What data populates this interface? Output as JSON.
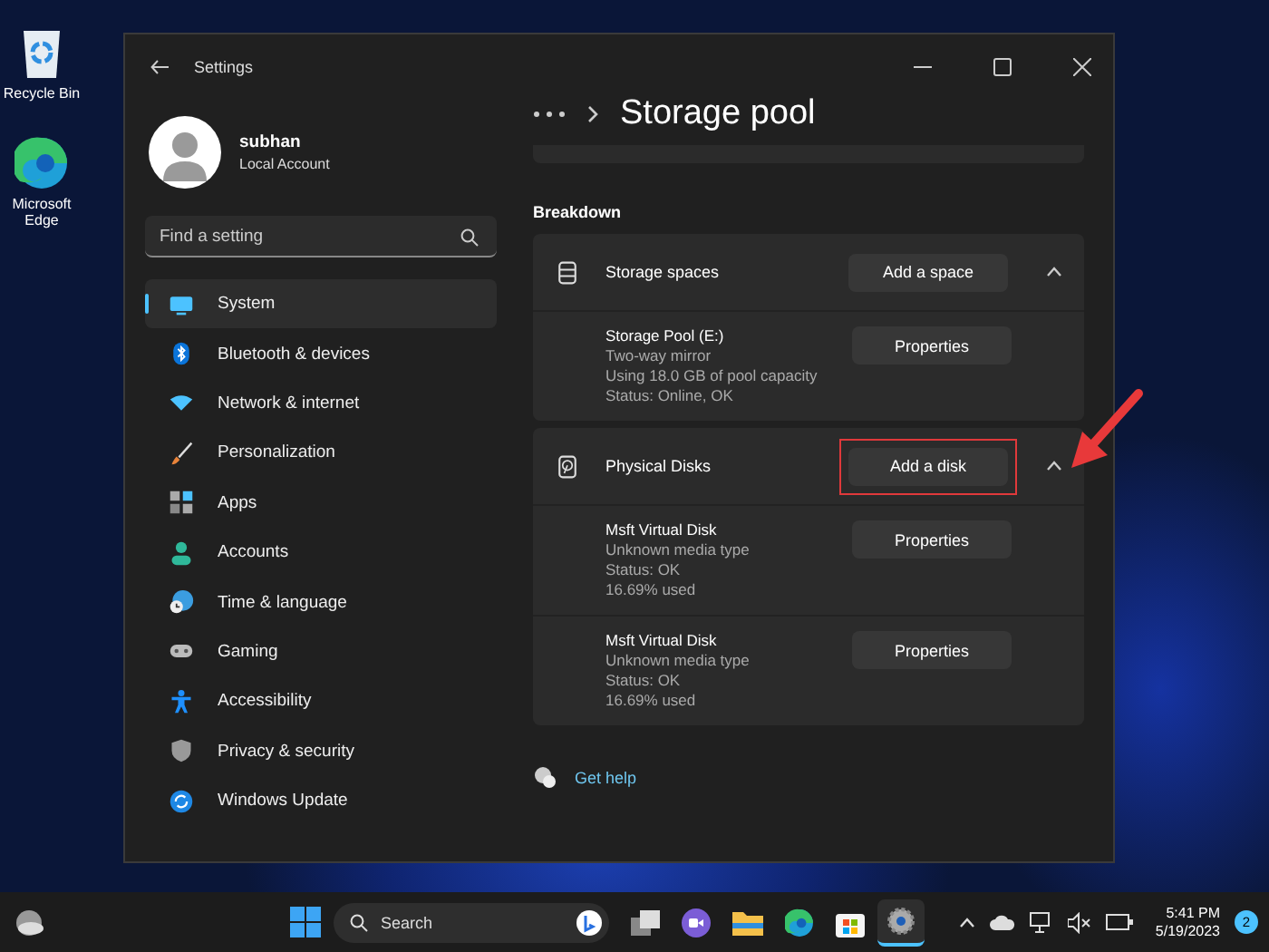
{
  "desktop_icons": [
    {
      "label": "Recycle Bin"
    },
    {
      "label": "Microsoft Edge"
    }
  ],
  "window": {
    "title": "Settings"
  },
  "profile": {
    "name": "subhan",
    "account_type": "Local Account"
  },
  "search": {
    "placeholder": "Find a setting"
  },
  "sidebar": {
    "items": [
      {
        "label": "System",
        "selected": true
      },
      {
        "label": "Bluetooth & devices",
        "selected": false
      },
      {
        "label": "Network & internet",
        "selected": false
      },
      {
        "label": "Personalization",
        "selected": false
      },
      {
        "label": "Apps",
        "selected": false
      },
      {
        "label": "Accounts",
        "selected": false
      },
      {
        "label": "Time & language",
        "selected": false
      },
      {
        "label": "Gaming",
        "selected": false
      },
      {
        "label": "Accessibility",
        "selected": false
      },
      {
        "label": "Privacy & security",
        "selected": false
      },
      {
        "label": "Windows Update",
        "selected": false
      }
    ]
  },
  "page_title": "Storage pool",
  "section_title": "Breakdown",
  "groups": [
    {
      "title": "Storage spaces",
      "action": "Add a space",
      "expanded": true,
      "highlighted": false,
      "items": [
        {
          "name": "Storage Pool (E:)",
          "details": [
            "Two-way mirror",
            "Using 18.0 GB of pool capacity",
            "Status: Online, OK"
          ],
          "button": "Properties"
        }
      ]
    },
    {
      "title": "Physical Disks",
      "action": "Add a disk",
      "expanded": true,
      "highlighted": true,
      "items": [
        {
          "name": "Msft Virtual Disk",
          "details": [
            "Unknown media type",
            "Status: OK",
            "16.69% used"
          ],
          "button": "Properties"
        },
        {
          "name": "Msft Virtual Disk",
          "details": [
            "Unknown media type",
            "Status: OK",
            "16.69% used"
          ],
          "button": "Properties"
        }
      ]
    }
  ],
  "help_link": "Get help",
  "taskbar": {
    "search_placeholder": "Search",
    "time": "5:41 PM",
    "date": "5/19/2023",
    "notification_count": "2"
  }
}
